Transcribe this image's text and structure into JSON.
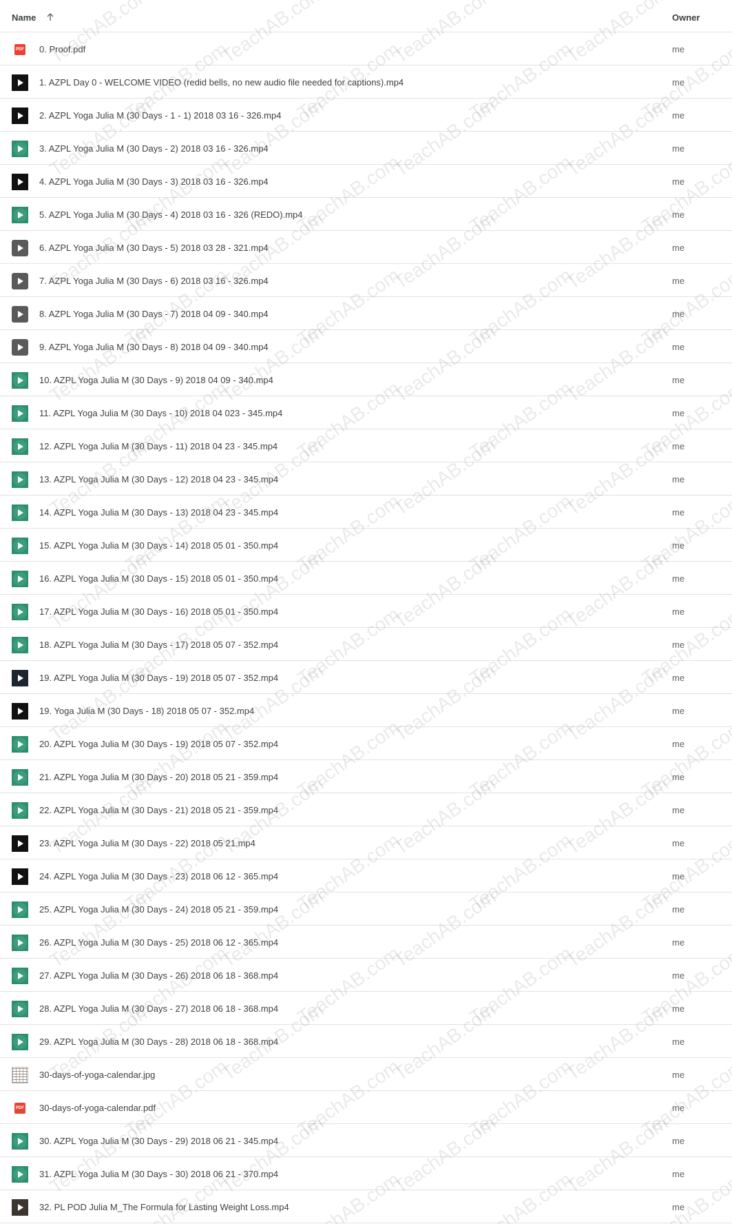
{
  "header": {
    "name_label": "Name",
    "owner_label": "Owner"
  },
  "watermark": "TeachAB.com",
  "files": [
    {
      "name": "0. Proof.pdf",
      "owner": "me",
      "icon": "pdf"
    },
    {
      "name": "1. AZPL Day 0 - WELCOME VIDEO (redid bells, no new audio file needed for captions).mp4",
      "owner": "me",
      "icon": "video-black"
    },
    {
      "name": "2. AZPL Yoga Julia M (30 Days - 1 - 1) 2018 03 16 - 326.mp4",
      "owner": "me",
      "icon": "video-black"
    },
    {
      "name": "3. AZPL Yoga Julia M (30 Days  - 2) 2018 03 16 - 326.mp4",
      "owner": "me",
      "icon": "video-green"
    },
    {
      "name": "4. AZPL Yoga Julia M (30 Days - 3) 2018 03 16 - 326.mp4",
      "owner": "me",
      "icon": "video-black"
    },
    {
      "name": "5. AZPL Yoga Julia M (30 Days - 4) 2018 03 16 - 326 (REDO).mp4",
      "owner": "me",
      "icon": "video-green"
    },
    {
      "name": "6. AZPL Yoga Julia M (30 Days - 5) 2018 03 28 - 321.mp4",
      "owner": "me",
      "icon": "video-gray"
    },
    {
      "name": "7. AZPL Yoga Julia M (30 Days - 6) 2018 03 16 - 326.mp4",
      "owner": "me",
      "icon": "video-gray"
    },
    {
      "name": "8. AZPL Yoga Julia M (30 Days - 7) 2018 04 09 - 340.mp4",
      "owner": "me",
      "icon": "video-gray"
    },
    {
      "name": "9. AZPL Yoga Julia M (30 Days - 8) 2018 04 09 - 340.mp4",
      "owner": "me",
      "icon": "video-gray"
    },
    {
      "name": "10. AZPL Yoga Julia M (30 Days - 9) 2018 04 09 - 340.mp4",
      "owner": "me",
      "icon": "video-green"
    },
    {
      "name": "11. AZPL Yoga Julia M (30 Days - 10) 2018 04 023 - 345.mp4",
      "owner": "me",
      "icon": "video-green"
    },
    {
      "name": "12. AZPL Yoga Julia M (30 Days - 11) 2018 04 23 - 345.mp4",
      "owner": "me",
      "icon": "video-green"
    },
    {
      "name": "13. AZPL Yoga Julia M (30 Days - 12) 2018 04 23 - 345.mp4",
      "owner": "me",
      "icon": "video-green"
    },
    {
      "name": "14. AZPL Yoga Julia M (30 Days - 13) 2018 04 23 - 345.mp4",
      "owner": "me",
      "icon": "video-green"
    },
    {
      "name": "15. AZPL Yoga Julia M (30 Days - 14) 2018 05 01 - 350.mp4",
      "owner": "me",
      "icon": "video-green"
    },
    {
      "name": "16. AZPL Yoga Julia M (30 Days - 15) 2018 05 01 - 350.mp4",
      "owner": "me",
      "icon": "video-green"
    },
    {
      "name": "17. AZPL Yoga Julia M (30 Days - 16) 2018 05 01 - 350.mp4",
      "owner": "me",
      "icon": "video-green"
    },
    {
      "name": "18. AZPL Yoga Julia M (30 Days - 17) 2018 05 07 - 352.mp4",
      "owner": "me",
      "icon": "video-green"
    },
    {
      "name": "19. AZPL Yoga Julia M (30 Days - 19) 2018 05 07 - 352.mp4",
      "owner": "me",
      "icon": "video-navy"
    },
    {
      "name": "19. Yoga Julia M (30 Days - 18) 2018 05 07 - 352.mp4",
      "owner": "me",
      "icon": "video-black"
    },
    {
      "name": "20. AZPL Yoga Julia M (30 Days - 19) 2018 05 07 - 352.mp4",
      "owner": "me",
      "icon": "video-green"
    },
    {
      "name": "21. AZPL Yoga Julia M (30 Days - 20) 2018 05 21 - 359.mp4",
      "owner": "me",
      "icon": "video-green"
    },
    {
      "name": "22. AZPL Yoga Julia M (30 Days - 21) 2018 05 21 - 359.mp4",
      "owner": "me",
      "icon": "video-green"
    },
    {
      "name": "23. AZPL Yoga Julia M (30 Days - 22) 2018 05 21.mp4",
      "owner": "me",
      "icon": "video-black"
    },
    {
      "name": "24. AZPL Yoga Julia M (30 Days - 23) 2018 06 12 - 365.mp4",
      "owner": "me",
      "icon": "video-black"
    },
    {
      "name": "25. AZPL Yoga Julia M (30 Days - 24) 2018 05 21 - 359.mp4",
      "owner": "me",
      "icon": "video-green"
    },
    {
      "name": "26. AZPL Yoga Julia M (30 Days - 25) 2018 06 12 - 365.mp4",
      "owner": "me",
      "icon": "video-green"
    },
    {
      "name": "27. AZPL Yoga Julia M (30 Days - 26) 2018 06 18 - 368.mp4",
      "owner": "me",
      "icon": "video-green"
    },
    {
      "name": "28. AZPL Yoga Julia M (30 Days - 27) 2018 06 18 - 368.mp4",
      "owner": "me",
      "icon": "video-green"
    },
    {
      "name": "29. AZPL Yoga Julia M (30 Days - 28) 2018 06 18 - 368.mp4",
      "owner": "me",
      "icon": "video-green"
    },
    {
      "name": "30-days-of-yoga-calendar.jpg",
      "owner": "me",
      "icon": "image"
    },
    {
      "name": "30-days-of-yoga-calendar.pdf",
      "owner": "me",
      "icon": "pdf"
    },
    {
      "name": "30. AZPL Yoga Julia M (30 Days - 29) 2018 06 21 - 345.mp4",
      "owner": "me",
      "icon": "video-green"
    },
    {
      "name": "31. AZPL Yoga Julia M (30 Days - 30) 2018 06 21 - 370.mp4",
      "owner": "me",
      "icon": "video-green"
    },
    {
      "name": "32. PL POD Julia M_The Formula for Lasting Weight Loss.mp4",
      "owner": "me",
      "icon": "video-dark"
    }
  ]
}
